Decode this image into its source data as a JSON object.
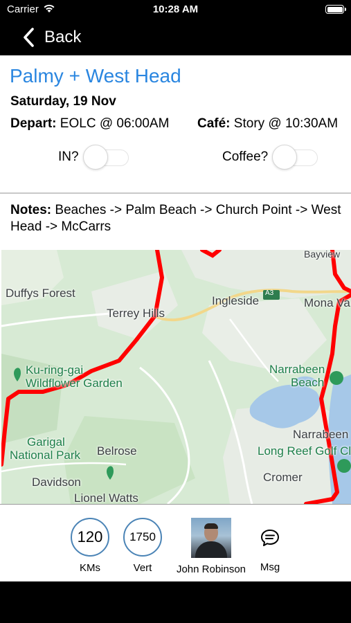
{
  "status_bar": {
    "carrier": "Carrier",
    "time": "10:28 AM"
  },
  "nav": {
    "back_label": "Back"
  },
  "ride": {
    "title": "Palmy + West Head",
    "date": "Saturday, 19 Nov",
    "depart_label": "Depart:",
    "depart_value": "EOLC @ 06:00AM",
    "cafe_label": "Café:",
    "cafe_value": "Story @ 10:30AM"
  },
  "toggles": {
    "in_label": "IN?",
    "in_on": false,
    "coffee_label": "Coffee?",
    "coffee_on": false
  },
  "notes": {
    "label": "Notes:",
    "text": "Beaches -> Palm Beach -> Church Point -> West Head -> McCarrs"
  },
  "map": {
    "route_color": "#ff0000",
    "labels": [
      "Duffys Forest",
      "Terrey Hills",
      "Ingleside",
      "A3",
      "Mona Va",
      "Bayview",
      "Ku-ring-gai",
      "Wildflower Garden",
      "Narrabeen",
      "Beach",
      "Narrabeen",
      "Long Reef Golf Cl",
      "Garigal",
      "National Park",
      "Belrose",
      "Cromer",
      "Davidson",
      "Lionel Watts"
    ]
  },
  "stats": {
    "kms_value": "120",
    "kms_label": "KMs",
    "vert_value": "1750",
    "vert_label": "Vert",
    "organizer_name": "John Robinson",
    "msg_label": "Msg"
  },
  "colors": {
    "title": "#2a86e0",
    "stat_ring": "#4b84b6"
  }
}
